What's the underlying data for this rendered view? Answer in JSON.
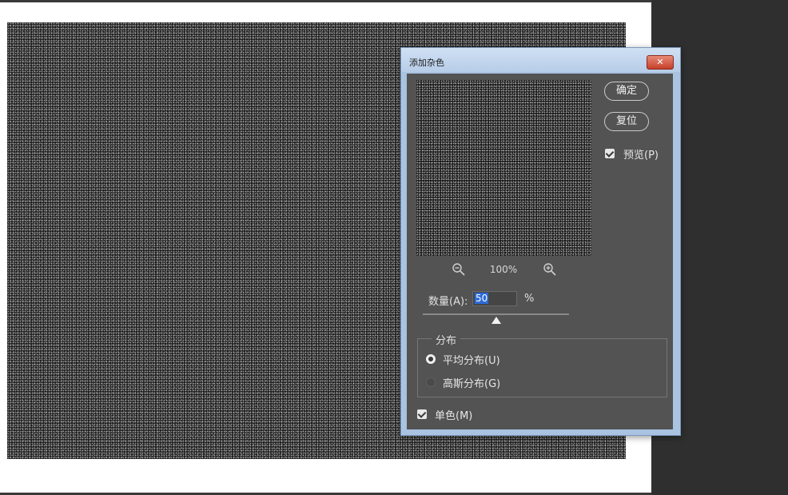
{
  "dialog": {
    "title": "添加杂色",
    "close_icon": "close-icon",
    "ok_label": "确定",
    "reset_label": "复位",
    "preview_label": "预览(P)",
    "preview_checked": true,
    "zoom_out_icon": "zoom-out-icon",
    "zoom_in_icon": "zoom-in-icon",
    "zoom_level": "100%",
    "amount_label": "数量(A):",
    "amount_value": "50",
    "amount_unit": "%",
    "amount_slider_fraction": 0.5,
    "distribution": {
      "label": "分布",
      "options": [
        "平均分布(U)",
        "高斯分布(G)"
      ],
      "selected": "平均分布(U)"
    },
    "mono_label": "单色(M)",
    "mono_checked": true
  },
  "colors": {
    "dialog_bg": "#535353",
    "titlebar": "#b7cde8",
    "workspace": "#2c2c2c",
    "close_button": "#c5402a",
    "selection_highlight": "#2d6ad8"
  }
}
